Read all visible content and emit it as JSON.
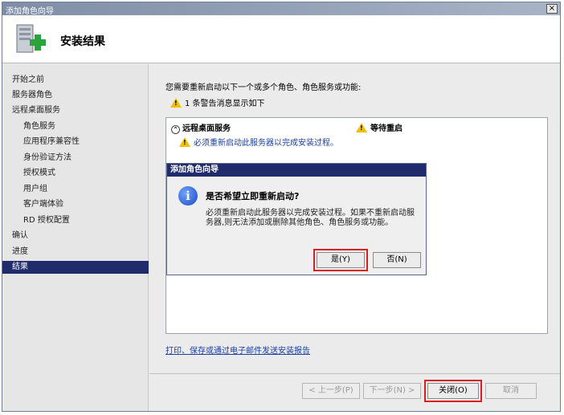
{
  "window": {
    "title": "添加角色向导",
    "close_glyph": "×"
  },
  "header": {
    "title": "安装结果"
  },
  "sidebar": {
    "items": [
      {
        "label": "开始之前"
      },
      {
        "label": "服务器角色"
      },
      {
        "label": "远程桌面服务"
      },
      {
        "label": "角色服务"
      },
      {
        "label": "应用程序兼容性"
      },
      {
        "label": "身份验证方法"
      },
      {
        "label": "授权模式"
      },
      {
        "label": "用户组"
      },
      {
        "label": "客户端体验"
      },
      {
        "label": "RD 授权配置"
      },
      {
        "label": "确认"
      },
      {
        "label": "进度"
      },
      {
        "label": "结果"
      }
    ],
    "selected": "结果"
  },
  "content": {
    "intro": "您需要重新启动以下一个或多个角色、角色服务或功能:",
    "warning_summary": "1 条警告消息显示如下",
    "result_role": "远程桌面服务",
    "result_status": "等待重启",
    "result_message": "必须重新启动此服务器以完成安装过程。",
    "report_link": "打印、保存或通过电子邮件发送安装报告"
  },
  "footer": {
    "prev": "< 上一步(P)",
    "next": "下一步(N) >",
    "close": "关闭(O)",
    "cancel": "取消"
  },
  "dialog": {
    "title": "添加角色向导",
    "question": "是否希望立即重新启动?",
    "body": "必须重新启动此服务器以完成安装过程。如果不重新启动服务器,则无法添加或删除其他角色、角色服务或功能。",
    "yes": "是(Y)",
    "no": "否(N)"
  },
  "colors": {
    "selection": "#1f2b6b",
    "highlight": "#d92020",
    "link": "#1a3f9e"
  }
}
